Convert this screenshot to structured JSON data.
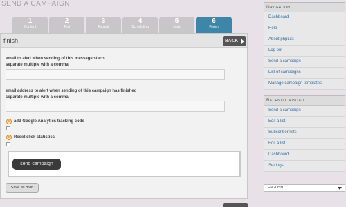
{
  "page_title": "SEND A CAMPAIGN",
  "steps": [
    {
      "num": "1",
      "label": "Content"
    },
    {
      "num": "2",
      "label": "Text"
    },
    {
      "num": "3",
      "label": "Format"
    },
    {
      "num": "4",
      "label": "Scheduling"
    },
    {
      "num": "5",
      "label": "Lists"
    },
    {
      "num": "6",
      "label": "Finish"
    }
  ],
  "panel": {
    "title": "finish",
    "back_label": "BACK"
  },
  "form": {
    "start_label_1": "email to alert when sending of this message starts",
    "start_label_2": "separate multiple with a comma",
    "start_value": "",
    "finish_label_1": "email address to alert when sending of this campaign has finished",
    "finish_label_2": "separate multiple with a comma",
    "finish_value": "",
    "analytics_label": "add Google Analytics tracking code",
    "reset_label": "Reset click statistics",
    "send_label": "send campaign",
    "draft_label": "Save as draft"
  },
  "navigation": {
    "heading": "Navigation",
    "items": [
      "Dashboard",
      "Help",
      "About phpList",
      "Log out",
      "Send a campaign",
      "List of campaigns",
      "Manage campaign templates"
    ]
  },
  "recent": {
    "heading": "Recently Visited",
    "items": [
      "Send a campaign",
      "Edit a list",
      "Subscriber lists",
      "Edit a list",
      "Dashboard",
      "Settings"
    ]
  },
  "language": "ENGLISH"
}
